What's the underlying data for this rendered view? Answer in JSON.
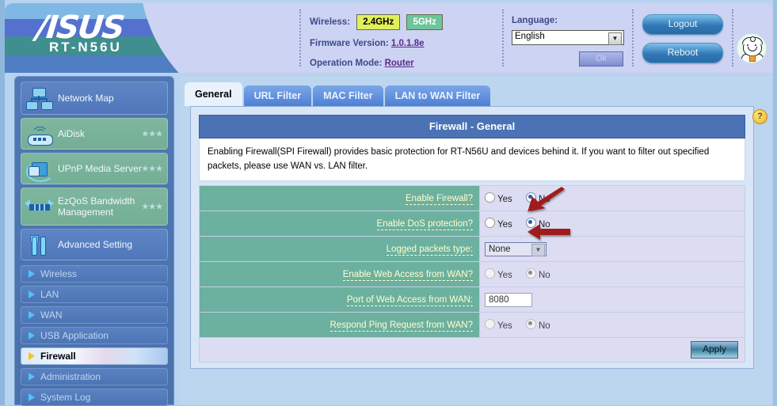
{
  "header": {
    "brand": "/ISUS",
    "model": "RT-N56U",
    "wireless_label": "Wireless:",
    "band_24": "2.4GHz",
    "band_5": "5GHz",
    "firmware_label": "Firmware Version:",
    "firmware_value": "1.0.1.8e",
    "opmode_label": "Operation Mode:",
    "opmode_value": "Router",
    "language_label": "Language:",
    "language_value": "English",
    "ok_label": "Ok",
    "logout_label": "Logout",
    "reboot_label": "Reboot",
    "avatar_name": "doctor-avatar"
  },
  "sidebar": {
    "big_items": [
      {
        "label": "Network Map",
        "icon": "network-map-icon",
        "stars": ""
      },
      {
        "label": "AiDisk",
        "icon": "router-wifi-icon",
        "stars": "★★★"
      },
      {
        "label": "UPnP Media Server",
        "icon": "upnp-icon",
        "stars": "★★★"
      },
      {
        "label": "EzQoS Bandwidth Management",
        "icon": "bandwidth-icon",
        "stars": "★★★"
      },
      {
        "label": "Advanced Setting",
        "icon": "tools-icon",
        "stars": ""
      }
    ],
    "menu_items": [
      {
        "label": "Wireless",
        "active": false
      },
      {
        "label": "LAN",
        "active": false
      },
      {
        "label": "WAN",
        "active": false
      },
      {
        "label": "USB Application",
        "active": false
      },
      {
        "label": "Firewall",
        "active": true
      },
      {
        "label": "Administration",
        "active": false
      },
      {
        "label": "System Log",
        "active": false
      }
    ]
  },
  "tabs": [
    {
      "label": "General",
      "active": true
    },
    {
      "label": "URL Filter",
      "active": false
    },
    {
      "label": "MAC Filter",
      "active": false
    },
    {
      "label": "LAN to WAN Filter",
      "active": false
    }
  ],
  "panel": {
    "title": "Firewall - General",
    "description": "Enabling Firewall(SPI Firewall) provides basic protection for RT-N56U and devices behind it. If you want to filter out specified packets, please use WAN vs. LAN filter.",
    "help_glyph": "?",
    "apply_label": "Apply",
    "yes_label": "Yes",
    "no_label": "No",
    "rows": [
      {
        "label": "Enable Firewall?",
        "type": "radio",
        "value": "No",
        "disabled": false,
        "annotated": true
      },
      {
        "label": "Enable DoS protection?",
        "type": "radio",
        "value": "No",
        "disabled": false,
        "annotated": true
      },
      {
        "label": "Logged packets type:",
        "type": "select",
        "value": "None",
        "disabled": false,
        "annotated": false
      },
      {
        "label": "Enable Web Access from WAN?",
        "type": "radio",
        "value": "No",
        "disabled": true,
        "annotated": false
      },
      {
        "label": "Port of Web Access from WAN:",
        "type": "text",
        "value": "8080",
        "disabled": true,
        "annotated": false
      },
      {
        "label": "Respond Ping Request from WAN?",
        "type": "radio",
        "value": "No",
        "disabled": true,
        "annotated": false
      }
    ]
  },
  "colors": {
    "accent_blue": "#4a72b4",
    "label_teal": "#6cb0a0",
    "label_text": "#ffffcc",
    "arrow_red": "#a01c1c",
    "badge_24ghz": "#e1ef5a",
    "badge_5ghz": "#6dc59a"
  }
}
